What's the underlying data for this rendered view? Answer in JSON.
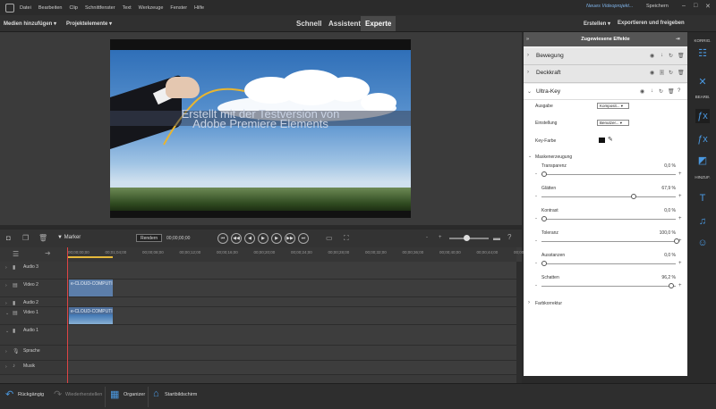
{
  "menu": [
    "Datei",
    "Bearbeiten",
    "Clip",
    "Schnittfenster",
    "Text",
    "Werkzeuge",
    "Fenster",
    "Hilfe"
  ],
  "project_name": "Neues Videoprojekt...",
  "save_label": "Speichern",
  "toolbar": {
    "add_media": "Medien hinzufügen",
    "project_assets": "Projektelemente",
    "modes": [
      "Schnell",
      "Assistent",
      "Experte"
    ],
    "active_mode": "Experte",
    "create": "Erstellen",
    "export": "Exportieren und freigeben"
  },
  "watermark": {
    "line1": "Erstellt mit der Testversion von",
    "line2": "Adobe Premiere Elements"
  },
  "timeline": {
    "marker": "Marker",
    "render": "Rendern",
    "timecode": "00;00;00;00",
    "ruler": [
      "00;00;00;00",
      "00;01;04;00",
      "00;00;08;00",
      "00;00;12;00",
      "00;00;16;00",
      "00;00;20;00",
      "00;00;24;00",
      "00;00;28;00",
      "00;00;32;00",
      "00;00;36;00",
      "00;00;40;00",
      "00;00;44;00",
      "00;00;48;00"
    ],
    "tracks": [
      {
        "name": "Audio 3",
        "type": "audio"
      },
      {
        "name": "Video 2",
        "type": "video",
        "clip": "e-CLOUD-COMPUTING"
      },
      {
        "name": "Audio 2",
        "type": "audio"
      },
      {
        "name": "Video 1",
        "type": "video",
        "clip": "e-CLOUD-COMPUTI"
      },
      {
        "name": "Audio 1",
        "type": "audio"
      },
      {
        "name": "Sprache",
        "type": "voice"
      },
      {
        "name": "Musik",
        "type": "music"
      }
    ]
  },
  "panel": {
    "title": "Zugewiesene Effekte",
    "sections": [
      "Bewegung",
      "Deckkraft",
      "Ultra-Key"
    ],
    "ultrakey": {
      "ausgabe_label": "Ausgabe",
      "ausgabe_value": "Komposit...",
      "einstellung_label": "Einstellung",
      "einstellung_value": "Benutzer...",
      "keyfarbe_label": "Key-Farbe"
    },
    "maskenerzeugung": "Maskenerzeugung",
    "params": [
      {
        "label": "Transparenz",
        "value": "0,0 %",
        "pos": 0.0
      },
      {
        "label": "Glätten",
        "value": "67,9 %",
        "pos": 0.679
      },
      {
        "label": "Kontrast",
        "value": "0,0 %",
        "pos": 0.0
      },
      {
        "label": "Toleranz",
        "value": "100,0 %",
        "pos": 1.0
      },
      {
        "label": "Ausstanzen",
        "value": "0,0 %",
        "pos": 0.0
      },
      {
        "label": "Schatten",
        "value": "96,2 %",
        "pos": 0.962
      }
    ],
    "farbkorrektur": "Farbkorrektur"
  },
  "rail": {
    "korrig": "KORRIG.",
    "bearb": "BEARB.",
    "hinzuf": "HINZUF."
  },
  "bottom": {
    "undo": "Rückgängig",
    "redo": "Wiederherstellen",
    "organizer": "Organizer",
    "home": "Startbildschirm"
  }
}
